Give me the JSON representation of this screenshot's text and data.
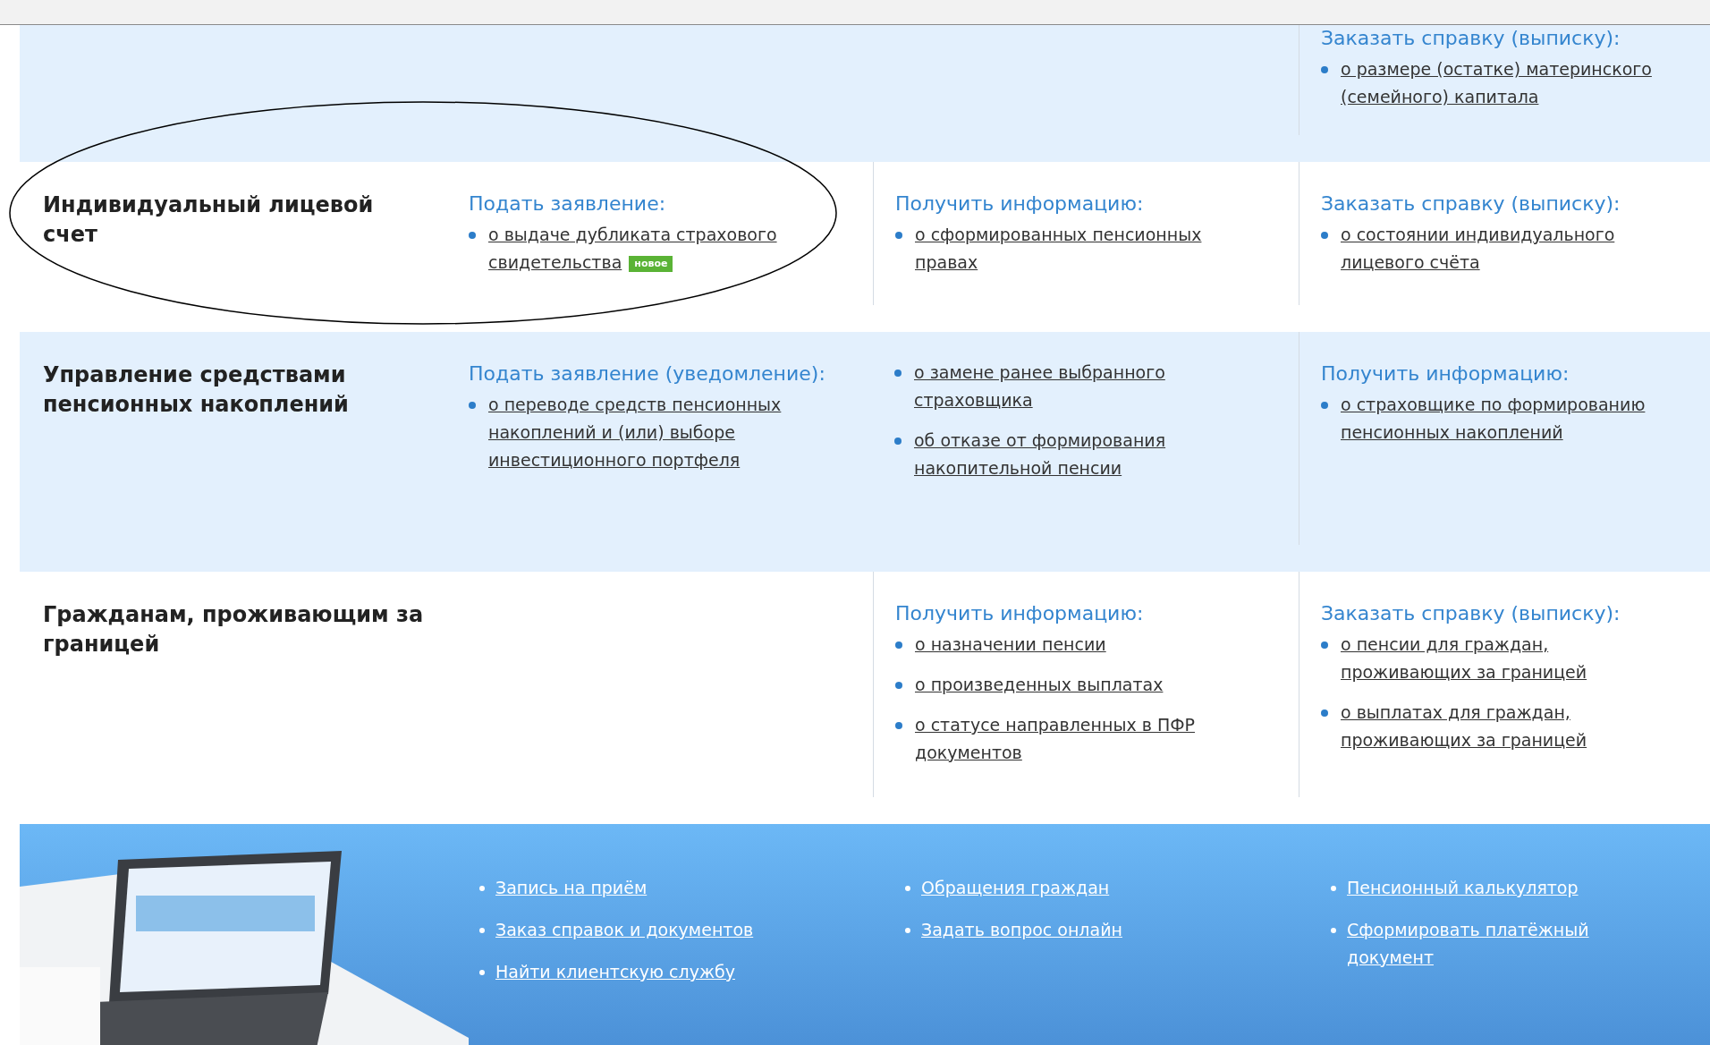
{
  "sections": [
    {
      "columns": [
        null,
        null,
        {
          "heading": "Заказать справку (выписку):",
          "links": [
            {
              "text": "о размере (остатке) материнского (семейного) капитала"
            }
          ]
        }
      ]
    },
    {
      "title": "Индивидуальный лицевой счет",
      "columns": [
        {
          "heading": "Подать заявление:",
          "links": [
            {
              "text": "о выдаче дубликата страхового свидетельства",
              "badge": "новое"
            }
          ]
        },
        {
          "heading": "Получить информацию:",
          "links": [
            {
              "text": "о сформированных пенсионных правах"
            }
          ]
        },
        {
          "heading": "Заказать справку (выписку):",
          "links": [
            {
              "text": "о состоянии индивидуального лицевого счёта"
            }
          ]
        }
      ]
    },
    {
      "title": "Управление средствами пенсионных накоплений",
      "columns": [
        {
          "heading": "Подать заявление (уведомление):",
          "links": [
            {
              "text": "о переводе средств пенсионных накоплений и (или) выборе инвестиционного портфеля"
            }
          ]
        },
        {
          "links": [
            {
              "text": "о замене ранее выбранного страховщика"
            },
            {
              "text": "об отказе от формирования накопительной пенсии"
            }
          ]
        },
        {
          "heading": "Получить информацию:",
          "links": [
            {
              "text": "о страховщике по формированию пенсионных накоплений"
            }
          ]
        }
      ]
    },
    {
      "title": "Гражданам, проживающим за границей",
      "columns": [
        null,
        {
          "heading": "Получить информацию:",
          "links": [
            {
              "text": "о назначении пенсии"
            },
            {
              "text": "о произведенных выплатах"
            },
            {
              "text": "о статусе направленных в ПФР документов"
            }
          ]
        },
        {
          "heading": "Заказать справку (выписку):",
          "links": [
            {
              "text": "о пенсии для граждан, проживающих за границей"
            },
            {
              "text": "о выплатах для граждан, проживающих за границей"
            }
          ]
        }
      ]
    }
  ],
  "footer": {
    "columns": [
      [
        "Запись на приём",
        "Заказ справок и документов",
        "Найти клиентскую службу"
      ],
      [
        "Обращения граждан",
        "Задать вопрос онлайн"
      ],
      [
        "Пенсионный калькулятор",
        "Сформировать платёжный документ"
      ]
    ]
  }
}
